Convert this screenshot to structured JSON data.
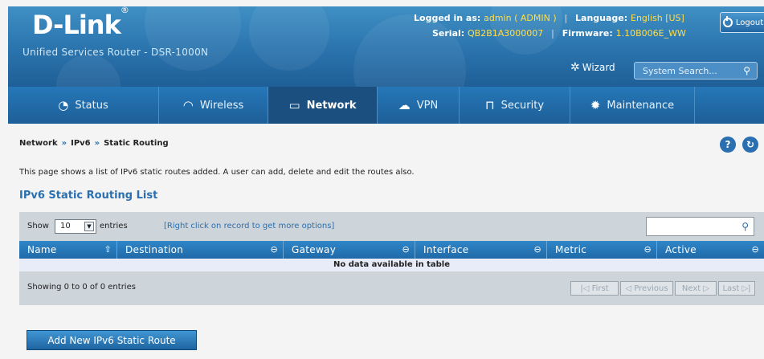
{
  "header": {
    "brand": "D-Link",
    "product": "Unified Services Router - DSR-1000N",
    "logged_in_label": "Logged in as:",
    "logged_in_value": "admin ( ADMIN )",
    "language_label": "Language:",
    "language_value": "English [US]",
    "serial_label": "Serial:",
    "serial_value": "QB2B1A3000007",
    "firmware_label": "Firmware:",
    "firmware_value": "1.10B006E_WW",
    "logout_label": "Logout",
    "wizard_label": "Wizard",
    "search_placeholder": "System Search..."
  },
  "nav": [
    {
      "label": "Status",
      "icon": "gauge-icon"
    },
    {
      "label": "Wireless",
      "icon": "wifi-icon"
    },
    {
      "label": "Network",
      "icon": "monitor-icon",
      "active": true
    },
    {
      "label": "VPN",
      "icon": "cloud-lock-icon"
    },
    {
      "label": "Security",
      "icon": "lock-icon"
    },
    {
      "label": "Maintenance",
      "icon": "gears-icon"
    }
  ],
  "breadcrumb": [
    "Network",
    "IPv6",
    "Static Routing"
  ],
  "description": "This page shows a list of IPv6 static routes added. A user can add, delete and edit the routes also.",
  "list_title": "IPv6 Static Routing List",
  "table": {
    "show_label": "Show",
    "page_size": "10",
    "entries_label": "entries",
    "hint": "[Right click on record to get more options]",
    "columns": [
      "Name",
      "Destination",
      "Gateway",
      "Interface",
      "Metric",
      "Active"
    ],
    "empty_message": "No data available in table",
    "showing": "Showing 0 to 0 of 0 entries",
    "pager": {
      "first": "First",
      "previous": "Previous",
      "next": "Next",
      "last": "Last"
    }
  },
  "add_button": "Add New IPv6 Static Route",
  "colors": {
    "accent": "#2a6fb0",
    "nav_active": "#1b4f80",
    "logged_value": "#ffde4a"
  }
}
